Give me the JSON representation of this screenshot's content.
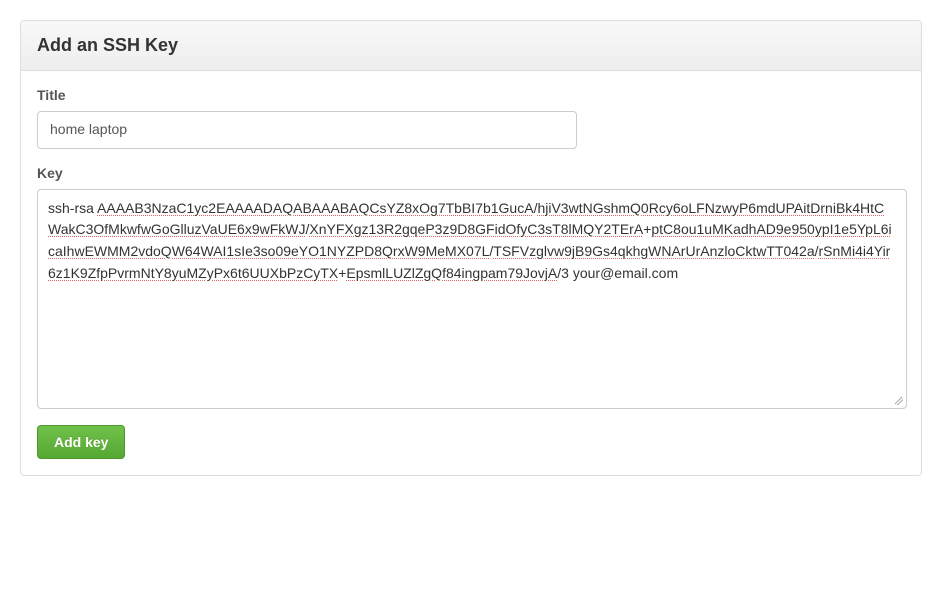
{
  "panel": {
    "title": "Add an SSH Key"
  },
  "form": {
    "title_label": "Title",
    "title_value": "home laptop",
    "key_label": "Key",
    "key_value": "ssh-rsa AAAAB3NzaC1yc2EAAAADAQABAAABAQCsYZ8xOg7TbBI7b1GucA/hjiV3wtNGshmQ0Rcy6oLFNzwyP6mdUPAitDrniBk4HtCWakC3OfMkwfwGoGlluzVaUE6x9wFkWJ/XnYFXgz13R2gqeP3z9D8GFidOfyC3sT8lMQY2TErA+ptC8ou1uMKadhAD9e950ypI1e5YpL6icaIhwEWMM2vdoQW64WAI1sIe3so09eYO1NYZPD8QrxW9MeMX07L/TSFVzglvw9jB9Gs4qkhgWNArUrAnzloCktwTT042a/rSnMi4i4Yir6z1K9ZfpPvrmNtY8yuMZyPx6t6UUXbPzCyTX+EpsmlLUZlZgQf84ingpam79JovjA/3 your@email.com",
    "submit_label": "Add key"
  }
}
